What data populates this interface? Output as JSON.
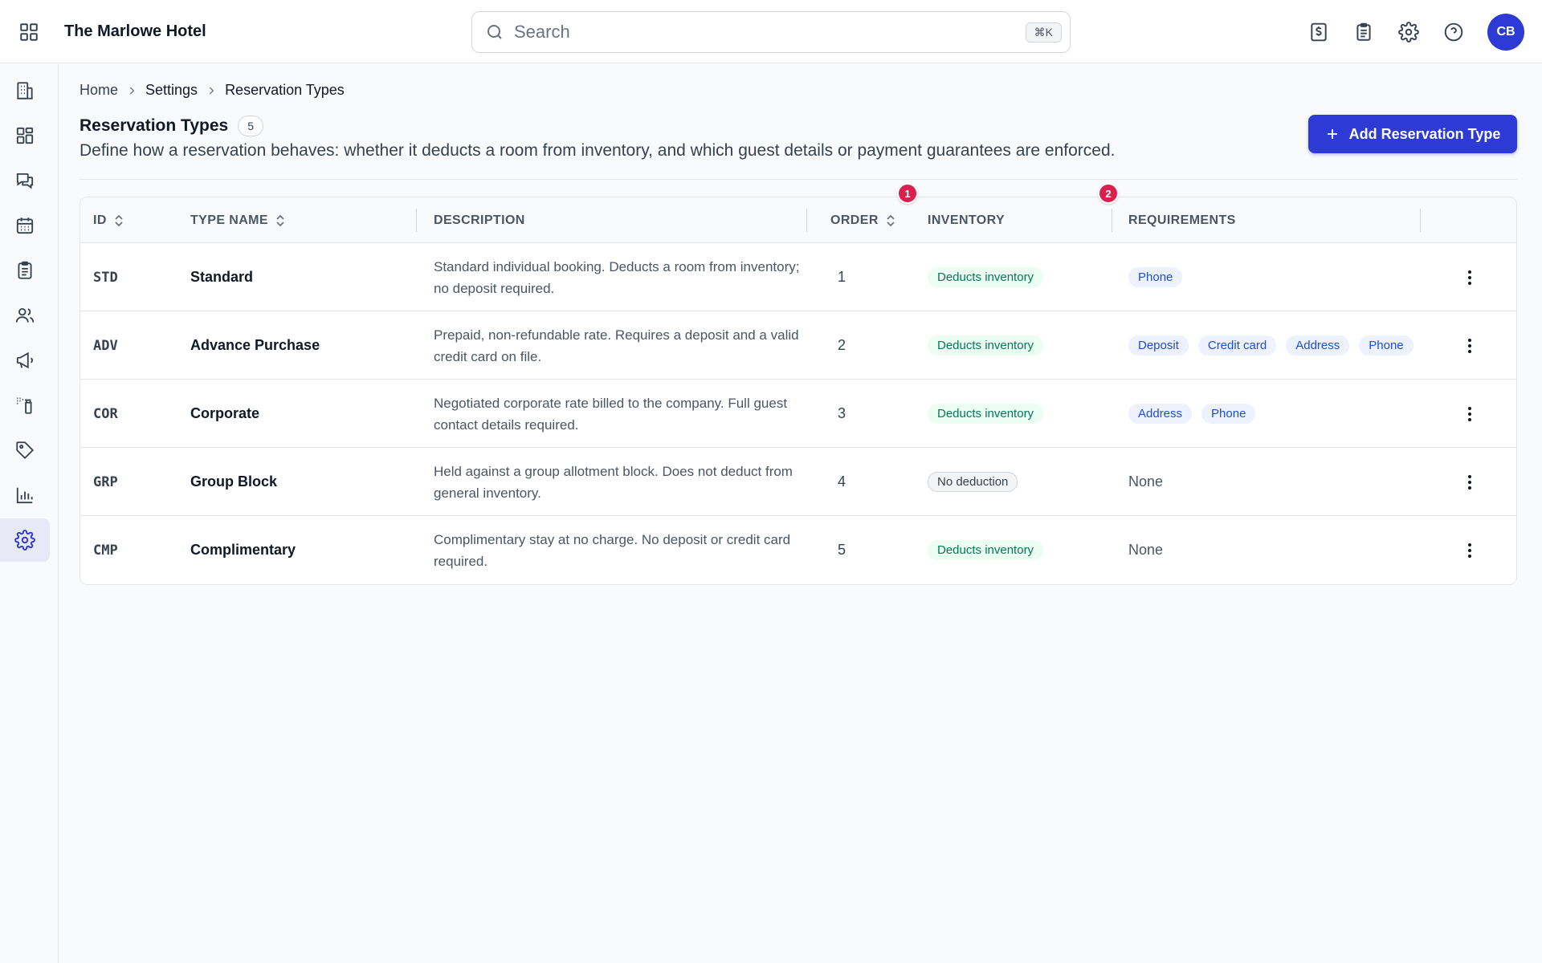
{
  "header": {
    "hotel_name": "The Marlowe Hotel",
    "search_placeholder": "Search",
    "search_shortcut": "⌘K",
    "icons": [
      "apps-grid-icon",
      "billing-icon",
      "clipboard-icon",
      "gear-icon",
      "help-icon"
    ],
    "avatar_initials": "CB"
  },
  "sidebar": {
    "items": [
      {
        "name": "properties",
        "icon": "building-icon"
      },
      {
        "name": "dashboard",
        "icon": "dashboard-icon"
      },
      {
        "name": "messages",
        "icon": "chat-icon"
      },
      {
        "name": "calendar",
        "icon": "calendar-icon"
      },
      {
        "name": "tasks",
        "icon": "clipboard-icon"
      },
      {
        "name": "guests",
        "icon": "users-icon"
      },
      {
        "name": "marketing",
        "icon": "megaphone-icon"
      },
      {
        "name": "housekeeping",
        "icon": "spray-icon"
      },
      {
        "name": "rates",
        "icon": "tag-icon"
      },
      {
        "name": "reports",
        "icon": "bar-chart-icon"
      },
      {
        "name": "settings",
        "icon": "gear-icon",
        "active": true
      }
    ]
  },
  "breadcrumb": [
    "Home",
    "Settings",
    "Reservation Types"
  ],
  "page": {
    "title": "Reservation Types",
    "count": "5",
    "subtitle": "Define how a reservation behaves: whether it deducts a room from inventory, and which guest details or payment guarantees are enforced.",
    "add_button_label": "Add Reservation Type"
  },
  "markers": [
    "1",
    "2"
  ],
  "table": {
    "columns": {
      "id": "ID",
      "type_name": "TYPE NAME",
      "description": "DESCRIPTION",
      "order": "ORDER",
      "inventory": "INVENTORY",
      "requirements": "REQUIREMENTS"
    },
    "rows": [
      {
        "id": "STD",
        "name": "Standard",
        "description": "Standard individual booking. Deducts a room from inventory; no deposit required.",
        "order": "1",
        "inventory": "Deducts inventory",
        "inventory_deducts": true,
        "requirements": [
          "Phone"
        ]
      },
      {
        "id": "ADV",
        "name": "Advance Purchase",
        "description": "Prepaid, non-refundable rate. Requires a deposit and a valid credit card on file.",
        "order": "2",
        "inventory": "Deducts inventory",
        "inventory_deducts": true,
        "requirements": [
          "Deposit",
          "Credit card",
          "Address",
          "Phone"
        ]
      },
      {
        "id": "COR",
        "name": "Corporate",
        "description": "Negotiated corporate rate billed to the company. Full guest contact details required.",
        "order": "3",
        "inventory": "Deducts inventory",
        "inventory_deducts": true,
        "requirements": [
          "Address",
          "Phone"
        ]
      },
      {
        "id": "GRP",
        "name": "Group Block",
        "description": "Held against a group allotment block. Does not deduct from general inventory.",
        "order": "4",
        "inventory": "No deduction",
        "inventory_deducts": false,
        "requirements": [],
        "requirements_empty": "None"
      },
      {
        "id": "CMP",
        "name": "Complimentary",
        "description": "Complimentary stay at no charge. No deposit or credit card required.",
        "order": "5",
        "inventory": "Deducts inventory",
        "inventory_deducts": true,
        "requirements": [],
        "requirements_empty": "None"
      }
    ]
  },
  "colors": {
    "accent": "#2d3ad6",
    "marker": "#dc1f4e",
    "green_text": "#047857",
    "blue_text": "#1d4ed8"
  }
}
